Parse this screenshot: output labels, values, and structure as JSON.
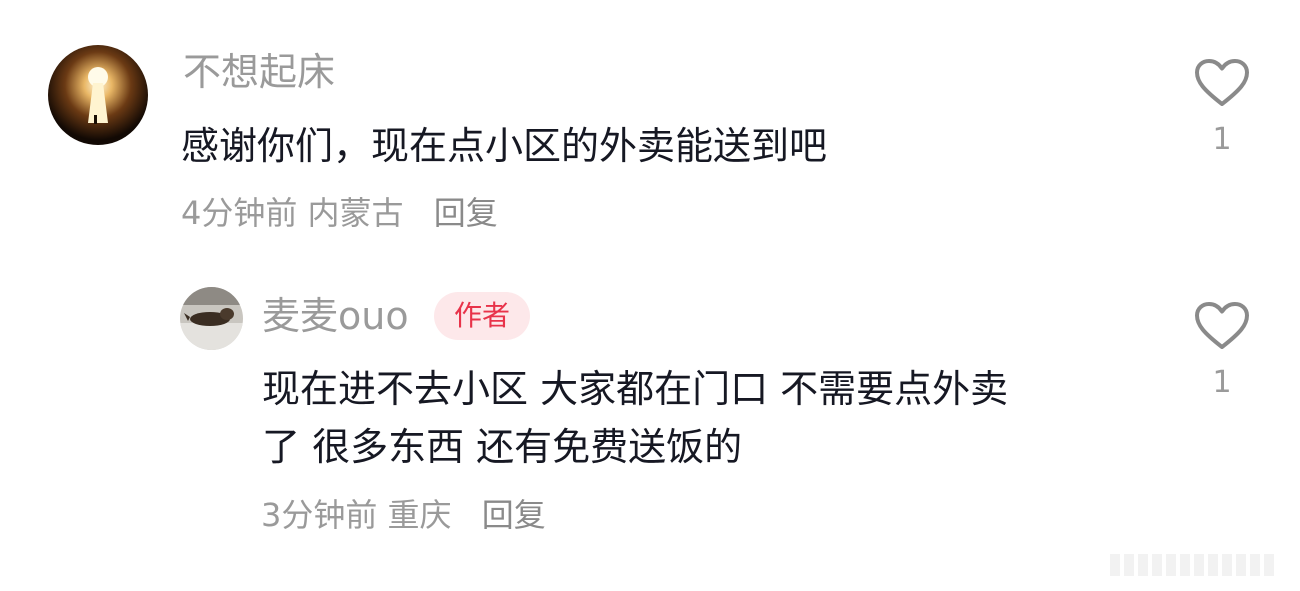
{
  "comments": [
    {
      "username": "不想起床",
      "content_lines": [
        "感谢你们，现在点小区的外卖能送到吧"
      ],
      "time": "4分钟前",
      "location": "内蒙古",
      "reply_label": "回复",
      "like_count": "1",
      "avatar_icon": "keyhole-light-icon"
    },
    {
      "username": "麦麦ouo",
      "badge": "作者",
      "content_lines": [
        "现在进不去小区 大家都在门口 不需要点外卖",
        "了 很多东西 还有免费送饭的"
      ],
      "time": "3分钟前",
      "location": "重庆",
      "reply_label": "回复",
      "like_count": "1",
      "avatar_icon": "dog-photo-icon"
    }
  ],
  "colors": {
    "text_primary": "#161823",
    "text_secondary": "#9a9a9a",
    "badge_bg": "#fde8ea",
    "badge_text": "#e8334a",
    "heart_stroke": "#8a8a8a"
  }
}
